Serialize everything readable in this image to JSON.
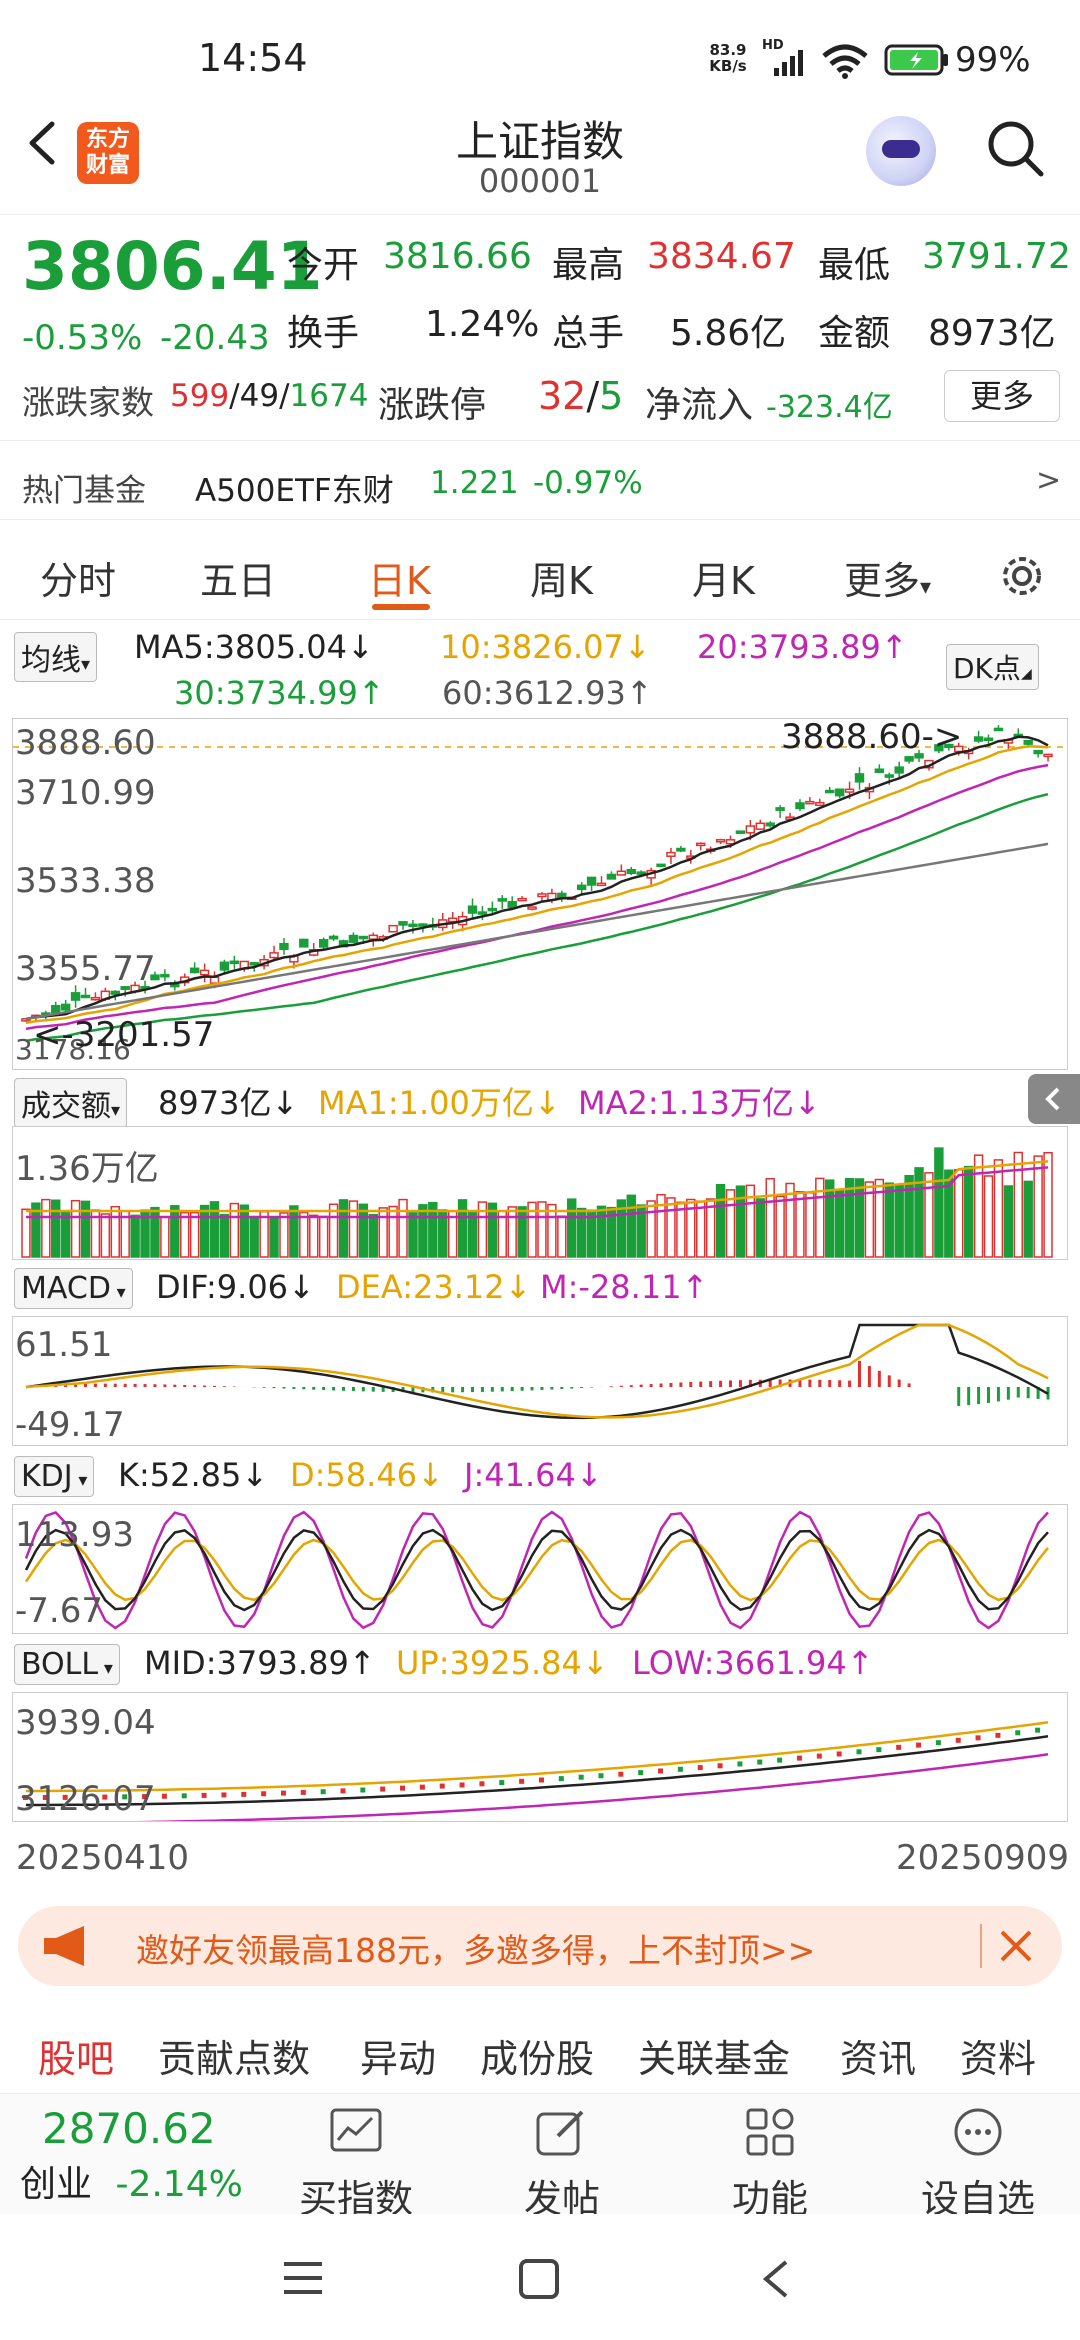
{
  "status_bar": {
    "time": "14:54",
    "net_speed_value": "83.9",
    "net_speed_unit": "KB/s",
    "network_label": "HD",
    "battery_pct": "99%"
  },
  "header": {
    "logo_text": "东方财富",
    "title": "上证指数",
    "code": "000001"
  },
  "quote": {
    "price": "3806.41",
    "change_pct": "-0.53%",
    "change": "-20.43",
    "open_label": "今开",
    "open": "3816.66",
    "high_label": "最高",
    "high": "3834.67",
    "low_label": "最低",
    "low": "3791.72",
    "turnover_label": "换手",
    "turnover": "1.24%",
    "volume_label": "总手",
    "volume": "5.86亿",
    "amount_label": "金额",
    "amount": "8973亿",
    "breadth_label": "涨跌家数",
    "breadth_up": "599",
    "breadth_flat": "49",
    "breadth_down": "1674",
    "limit_label": "涨跌停",
    "limit_up": "32",
    "limit_down": "5",
    "netflow_label": "净流入",
    "netflow": "-323.4亿",
    "more_button": "更多"
  },
  "hot_fund": {
    "label": "热门基金",
    "name": "A500ETF东财",
    "price": "1.221",
    "change": "-0.97%",
    "arrow": ">"
  },
  "tabs": [
    {
      "label": "分时"
    },
    {
      "label": "五日"
    },
    {
      "label": "日K"
    },
    {
      "label": "周K"
    },
    {
      "label": "月K"
    },
    {
      "label": "更多"
    }
  ],
  "ma_legend": {
    "selector": "均线",
    "ma5": "MA5:3805.04",
    "ma10": "10:3826.07",
    "ma20": "20:3793.89",
    "ma30": "30:3734.99",
    "ma60": "60:3612.93",
    "dk_button": "DK点"
  },
  "kline": {
    "y_labels": [
      "3888.60",
      "3710.99",
      "3533.38",
      "3355.77",
      "3178.16"
    ],
    "max_marker": "3888.60->",
    "min_marker": "<-3201.57"
  },
  "volume": {
    "selector": "成交额",
    "value": "8973亿",
    "ma1": "MA1:1.00万亿",
    "ma2": "MA2:1.13万亿",
    "y_label": "1.36万亿"
  },
  "macd": {
    "selector": "MACD",
    "dif": "DIF:9.06",
    "dea": "DEA:23.12",
    "m": "M:-28.11",
    "y_top": "61.51",
    "y_bottom": "-49.17"
  },
  "kdj": {
    "selector": "KDJ",
    "k": "K:52.85",
    "d": "D:58.46",
    "j": "J:41.64",
    "y_top": "113.93",
    "y_bottom": "-7.67"
  },
  "boll": {
    "selector": "BOLL",
    "mid": "MID:3793.89",
    "up": "UP:3925.84",
    "low": "LOW:3661.94",
    "y_top": "3939.04",
    "y_bottom": "3126.07"
  },
  "date_axis": {
    "start": "20250410",
    "end": "20250909"
  },
  "banner": {
    "text": "邀好友领最高188元，多邀多得，上不封顶>>"
  },
  "bottom_tabs": [
    {
      "label": "股吧"
    },
    {
      "label": "贡献点数"
    },
    {
      "label": "异动"
    },
    {
      "label": "成份股"
    },
    {
      "label": "关联基金"
    },
    {
      "label": "资讯"
    },
    {
      "label": "资料"
    }
  ],
  "toolbar": {
    "chinext_value": "2870.62",
    "chinext_label": "创业",
    "chinext_change": "-2.14%",
    "buy_label": "买指数",
    "post_label": "发帖",
    "func_label": "功能",
    "watch_label": "设自选"
  },
  "colors": {
    "up": "#e03131",
    "down": "#1a9e3a",
    "accent": "#e25a18",
    "ma10": "#e6a400",
    "ma20": "#c026b5"
  }
}
